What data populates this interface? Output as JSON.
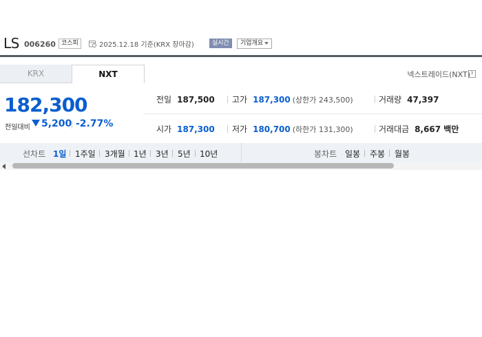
{
  "header": {
    "name": "LS",
    "code": "006260",
    "market": "코스피",
    "date": "2025.12.18 기준(KRX 장마감)",
    "realtime": "실시간",
    "company_info": "기업개요"
  },
  "tabs": [
    "KRX",
    "NXT"
  ],
  "nxt_info": "넥스트레이드(NXT)",
  "price": {
    "current": "182,300",
    "change_label": "전일대비",
    "change": "5,200",
    "change_pct": "-2.77%"
  },
  "stats": {
    "prev_label": "전일",
    "prev": "187,500",
    "high_label": "고가",
    "high": "187,300",
    "upper": "(상한가 243,500)",
    "volume_label": "거래량",
    "volume": "47,397",
    "open_label": "시가",
    "open": "187,300",
    "low_label": "저가",
    "low": "180,700",
    "lower": "(하한가 131,300)",
    "amount_label": "거래대금",
    "amount": "8,667 백만"
  },
  "toolbar": {
    "line_label": "선차트",
    "line_periods": [
      "1일",
      "1주일",
      "3개월",
      "1년",
      "3년",
      "5년",
      "10년"
    ],
    "candle_label": "봉차트",
    "candle_periods": [
      "일봉",
      "주봉",
      "월봉"
    ]
  },
  "colors": {
    "down": "#0a5ecf",
    "realtime_badge": "#7f8db1"
  }
}
